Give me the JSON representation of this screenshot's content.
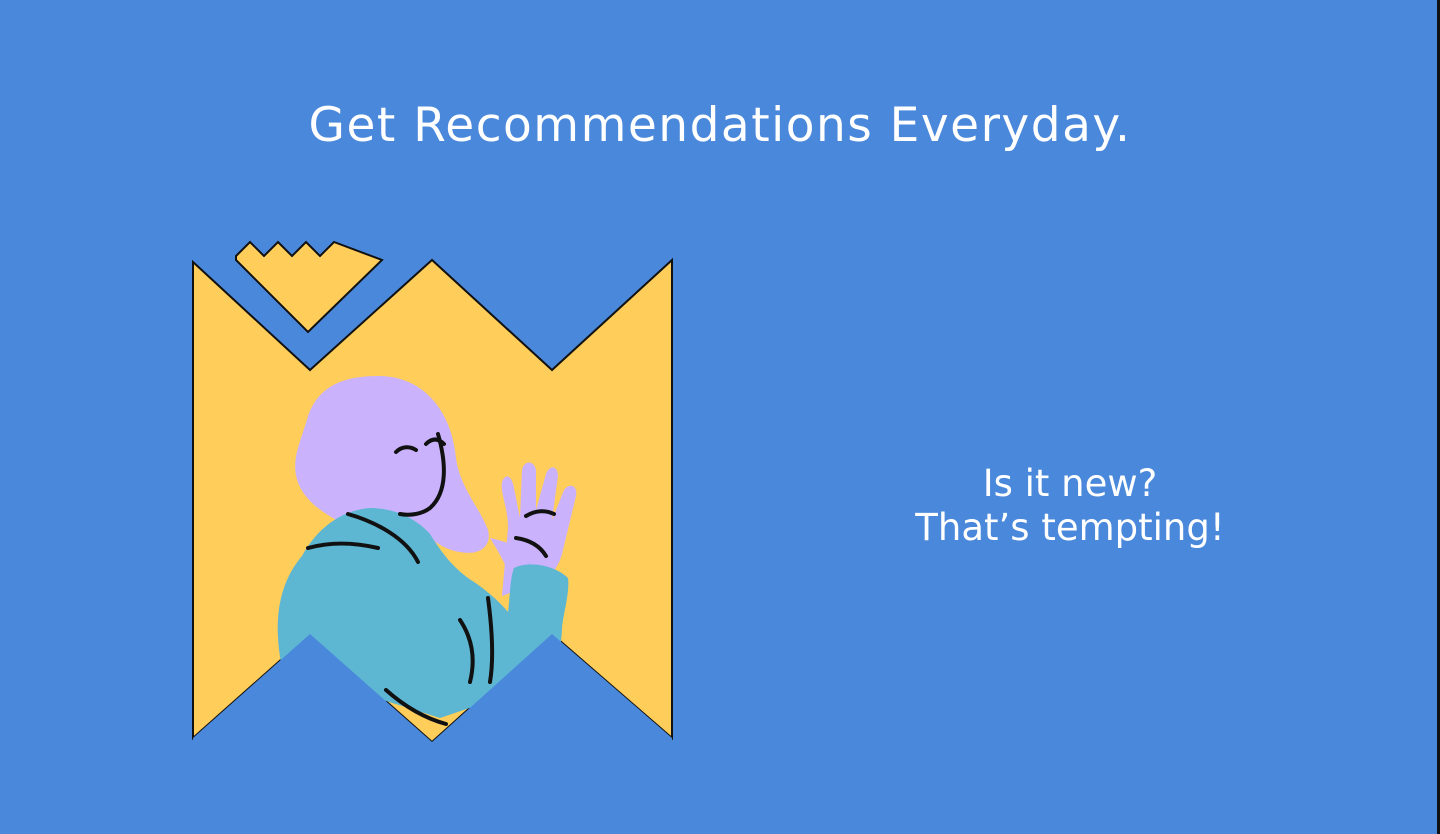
{
  "headline": "Get Recommendations Everyday.",
  "tagline": {
    "line1": "Is it new?",
    "line2": "That’s tempting!"
  },
  "illustration": {
    "subject": "person-waving-in-window",
    "colors": {
      "background": "#4a88db",
      "frame": "#fecd5a",
      "hair": "#cbb2fd",
      "skin": "#cbb2fd",
      "sweater": "#5db7d3",
      "outline": "#111111"
    }
  }
}
